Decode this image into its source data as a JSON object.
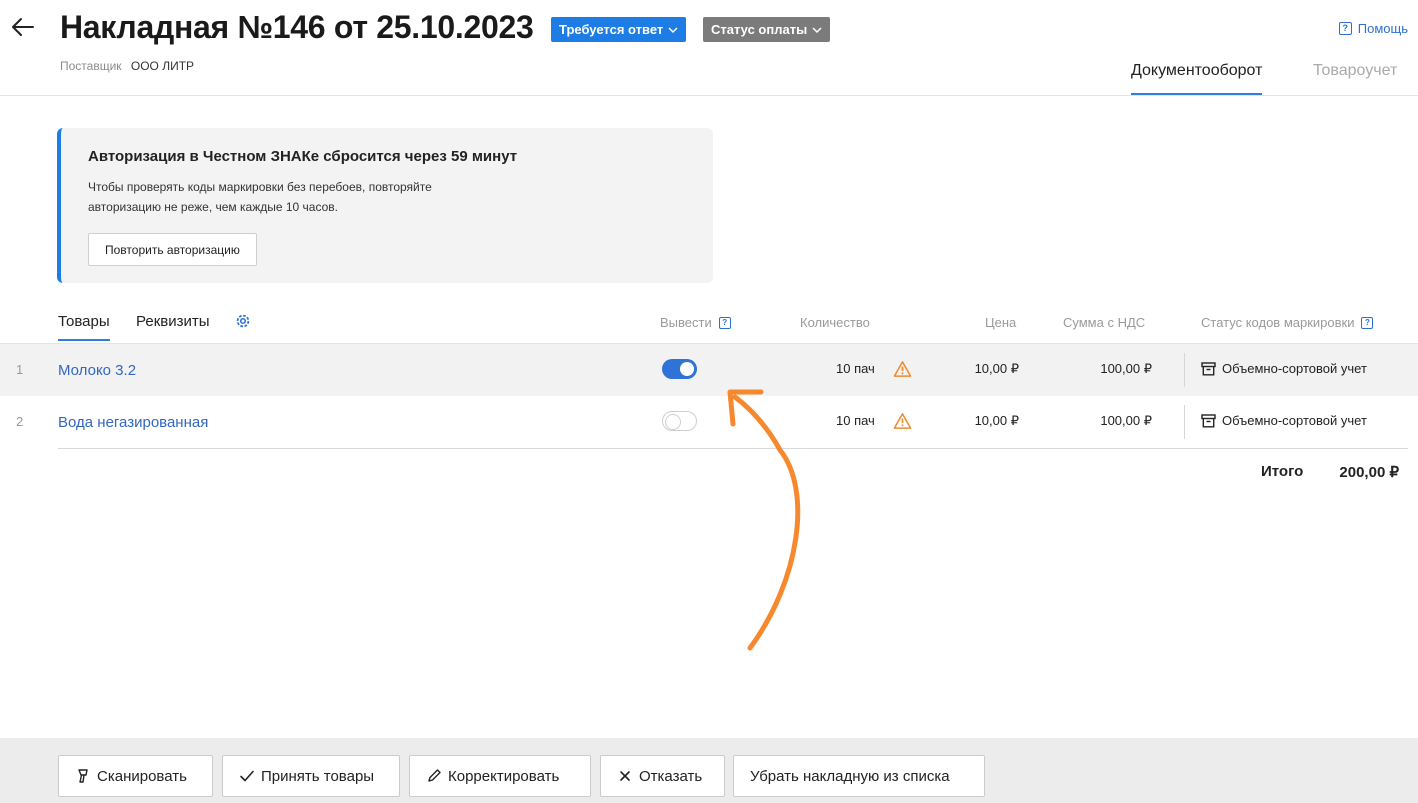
{
  "header": {
    "title": "Накладная №146 от 25.10.2023",
    "badge_reply": "Требуется ответ",
    "badge_payment": "Статус оплаты",
    "supplier_label": "Поставщик",
    "supplier_value": "ООО ЛИТР",
    "help": "Помощь",
    "tabs": [
      {
        "label": "Документооборот",
        "active": true
      },
      {
        "label": "Товароучет",
        "active": false
      }
    ]
  },
  "alert": {
    "title": "Авторизация в Честном ЗНАКе сбросится через 59 минут",
    "text_line1": "Чтобы проверять коды маркировки без перебоев, повторяйте",
    "text_line2": "авторизацию не реже, чем каждые 10 часов.",
    "button": "Повторить авторизацию"
  },
  "table": {
    "tabs": [
      {
        "label": "Товары",
        "active": true
      },
      {
        "label": "Реквизиты",
        "active": false
      }
    ],
    "columns": {
      "export": "Вывести",
      "quantity": "Количество",
      "price": "Цена",
      "sum": "Сумма с НДС",
      "status": "Статус кодов маркировки"
    },
    "rows": [
      {
        "num": "1",
        "name": "Молоко 3.2",
        "export_on": true,
        "quantity": "10 пач",
        "price": "10,00 ₽",
        "sum": "100,00 ₽",
        "status": "Объемно-сортовой учет"
      },
      {
        "num": "2",
        "name": "Вода негазированная",
        "export_on": false,
        "quantity": "10 пач",
        "price": "10,00 ₽",
        "sum": "100,00 ₽",
        "status": "Объемно-сортовой учет"
      }
    ],
    "total_label": "Итого",
    "total_value": "200,00 ₽"
  },
  "footer": {
    "scan": "Сканировать",
    "accept": "Принять товары",
    "correct": "Корректировать",
    "refuse": "Отказать",
    "remove": "Убрать накладную из списка"
  },
  "colors": {
    "accent": "#1e7de5",
    "link": "#3267c2",
    "warning": "#f08a2c",
    "annotation_arrow": "#f6892e"
  },
  "icons": [
    "back-arrow-icon",
    "chevron-down-icon",
    "help-icon",
    "gear-icon",
    "warning-icon",
    "box-icon",
    "scan-icon",
    "check-icon",
    "pencil-icon",
    "close-icon"
  ]
}
